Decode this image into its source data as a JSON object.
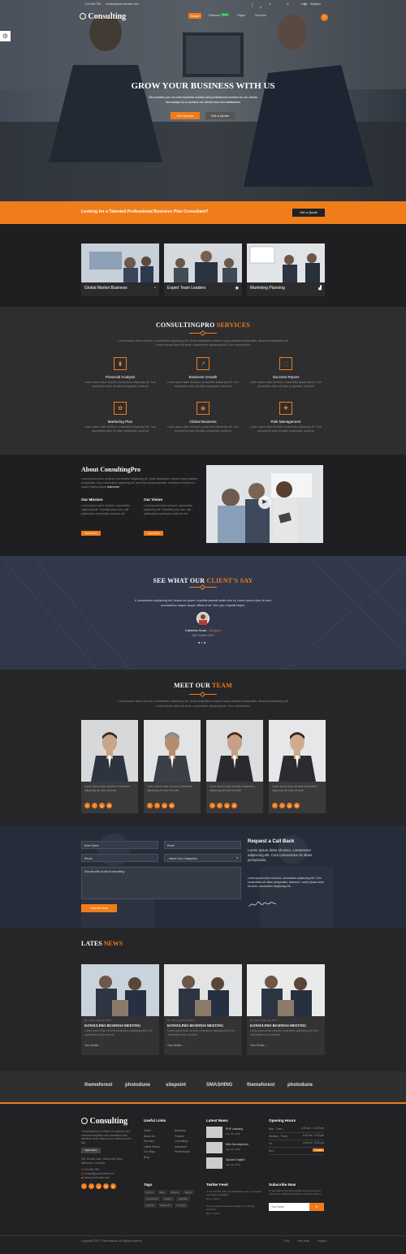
{
  "header": {
    "phone": "123-456-789",
    "email": "contact@yourdomain.com",
    "login": "Login",
    "register": "Register",
    "logo": "Consulting",
    "nav": [
      "Home",
      "Features",
      "Pages",
      "Services"
    ],
    "nav_badge": "New"
  },
  "hero": {
    "title": "GROW YOUR BUSINESS WITH US",
    "line1": "We provides you our best business solution and professional services for our clients",
    "line2": "and always try to achieve our clients trust and satisfaction",
    "btn_primary": "Our Service",
    "btn_secondary": "Get a Quote"
  },
  "cta_bar": {
    "text": "Looking for a Talented Professional Business Plan Consultant?",
    "button": "Get a Quote"
  },
  "feature_cards": [
    {
      "label": "Global Market Business"
    },
    {
      "label": "Expert Team Leaders"
    },
    {
      "label": "Marketing Planning"
    }
  ],
  "services": {
    "title_a": "CONSULTINGPRO",
    "title_b": "SERVICES",
    "intro1": "Lorem ipsum dolor sit amet, consectetur adipiscing elit. Quae exspiration mauen noque pariteur perspiciatis, deserunt adipiscing elit",
    "intro2": "Lorem ipsum dolor sit amet, consectetur adipiscing elit. Cum consectetur",
    "items": [
      {
        "name": "Financial Analysis",
        "text": "Lorem ipsum dolor sit amet, consectetur adipiscing elit. Cum consectetur dolor sit ullam perspiciatis, deserunt"
      },
      {
        "name": "Business Growth",
        "text": "Lorem ipsum dolor sit amet, consectetur adipiscing elit. Cum consectetur dolor sit ullam perspiciatis, deserunt"
      },
      {
        "name": "Success Report",
        "text": "Lorem ipsum dolor sit amet, consectetur adipiscing elit. Cum consectetur dolor sit ullam perspiciatis, deserunt"
      },
      {
        "name": "Marketing Plan",
        "text": "Lorem ipsum dolor sit amet, consectetur adipiscing elit. Cum consectetur dolor sit ullam perspiciatis, deserunt"
      },
      {
        "name": "Global Business",
        "text": "Lorem ipsum dolor sit amet, consectetur adipiscing elit. Cum consectetur dolor sit ullam perspiciatis, deserunt"
      },
      {
        "name": "Risk Management",
        "text": "Lorem ipsum dolor sit amet, consectetur adipiscing elit. Cum consectetur dolor sit ullam perspiciatis, deserunt"
      }
    ]
  },
  "about": {
    "title": "About ConsultingPro",
    "text": "Lorem ipsum dolor sit amet, consectetur adipiscing elit. Quae exspiration mauen noque pariteur perspiciatis. Cum consectetur adipiscing elit, sed diam quiam sperialer. Incididunt ut labore et dolore magna aliqua",
    "read_more": "read more",
    "mission_title": "Our Mission",
    "mission_text": "Lorem ipsum dolor sit amet, consectetur adipiscing elit. Expedita porro iure, odit quibusdam repellendus dolorum est",
    "vision_title": "Our Vision",
    "vision_text": "Lorem ipsum dolor sit amet, consectetur adipiscing elit. Expedita porro iure, odit quibusdam repellendus dolorum est",
    "btn": "Read More"
  },
  "testimonial": {
    "title_a": "SEE WHAT OUR",
    "title_b": "CLIENT'S SAY",
    "quote1": "it, consectetur adipisicing elit. Neque est quam, expedita placeat facilis odio eu   Lorem ipsum dolor sit ame",
    "quote2": "accusantium eaque iusque officiis et sit. Vero quo, impedit neque.",
    "name": "Catherine Grace",
    "role": "Designer",
    "date": "26th October 2017"
  },
  "team": {
    "title_a": "MEET OUR",
    "title_b": "TEAM",
    "intro1": "Lorem ipsum dolor sit amet, consectetur adipiscing elit. Quae exspiration mauen noque pariteur perspiciatis, deserunt adipiscing elit",
    "intro2": "Lorem ipsum dolor sit amet, consectetur adipiscing elit. Cum consectetur",
    "member_text": "Lorem ipsum dolor sit amet consectetur adipiscing elit dolor sit amet",
    "members": [
      {
        "n": "1"
      },
      {
        "n": "2"
      },
      {
        "n": "3"
      },
      {
        "n": "4"
      }
    ]
  },
  "contact": {
    "name_ph": "Enter Name",
    "email_ph": "Email",
    "phone_ph": "Phone",
    "select": "- Select Your Categories",
    "message_ph": "Discuss with us about consulting",
    "submit": "Submit Now",
    "side_title": "Request a Call Back",
    "side_text": "Lorem ipsum dolor sit amet, consectetur adipiscing elit. Cum consectetur sit ullam perspiciatis.",
    "side_text2": "Lorem ipsum dolor sit amet, consectetur adipiscing elit. Cum consectetur sit ullam perspiciatis, deserunt. Lorem ipsum dolor sit amet, consectetur adipiscing elit."
  },
  "news": {
    "title_a": "LATES",
    "title_b": "NEWS",
    "items": [
      {
        "meta": "By: Admin   June 26, 2017",
        "title": "KONSULPRO BUSINESS MEETING",
        "text": "Lorem ipsum dolor sit amet consectetur adipiscing elit Cum consectetur dolor sit amet",
        "more": "View Details →"
      },
      {
        "meta": "By: Admin   June 26, 2017",
        "title": "KONSULPRO BUSINESS MEETING",
        "text": "Lorem ipsum dolor sit amet consectetur adipiscing elit Cum consectetur dolor sit amet",
        "more": "View Details →"
      },
      {
        "meta": "By: Admin   June 26, 2017",
        "title": "KONSULPRO BUSINESS MEETING",
        "text": "Lorem ipsum dolor sit amet consectetur adipiscing elit Cum consectetur dolor sit amet",
        "more": "View Details →"
      }
    ]
  },
  "partners": [
    "themeforest",
    "photodune",
    "sitepoint",
    "SMASHING",
    "themeforest",
    "photodune"
  ],
  "footer": {
    "logo": "Consulting",
    "about": "ThemeMascot is a theme of corporate and business templates with predefined web elements which helps you to build your own site.",
    "read_more": "Read More",
    "address": "203, Envato Labs, Behind Alis Steet, Melbourne, Australia.",
    "phone": "123-456-789",
    "email": "contact@yourdomain.com",
    "web": "www.yourdomain.com",
    "links_title": "Useful Links",
    "links_a": [
      "Home",
      "About Us",
      "Services",
      "Latest Works",
      "Our Blog",
      "Blog"
    ],
    "links_b": [
      "Business",
      "Finance",
      "Consulting",
      "Insurance",
      "Professional"
    ],
    "news_title": "Latest News",
    "news": [
      {
        "t": "PHP Learning",
        "d": "Mar 08, 2015"
      },
      {
        "t": "Web Development",
        "d": "Mar 08, 2015"
      },
      {
        "t": "Spoken English",
        "d": "Mar 08, 2015"
      }
    ],
    "hours_title": "Opening Hours",
    "hours": [
      {
        "d": "Mon - Tues :",
        "h": "6.00 am - 10.00 pm"
      },
      {
        "d": "Wednes - Thurs :",
        "h": "8.00 am - 6.00 pm"
      },
      {
        "d": "Fri :",
        "h": "3.00 pm - 8.00 pm"
      },
      {
        "d": "Sun :",
        "h": "Closed"
      }
    ],
    "tags_title": "Tags",
    "tags": [
      "Lorem",
      "Blog",
      "Market",
      "Eigner",
      "Consultant",
      "Design",
      "Dribbble",
      "Joomla",
      "Business",
      "Tourism"
    ],
    "twitter_title": "Twitter Feed",
    "tweet1": "Ho Tim'hui with your WordPress site. Jst install our plugin highlights",
    "tweet1_date": "Dec 4, 2017",
    "tweet2": "As sections reuse and design. No in blog structure",
    "tweet2_date": "Dec 4, 2017",
    "subscribe_title": "Subscribe Now",
    "subscribe_text": "To get latest news and update keep connected with us by mailing Subscribe to connect with us",
    "email_ph": "Your Email",
    "copyright": "Copyright ©2017 ThemeMascot. All Rights Reserved",
    "bottom_links": [
      "FAQ",
      "Help Desk",
      "Support"
    ]
  }
}
